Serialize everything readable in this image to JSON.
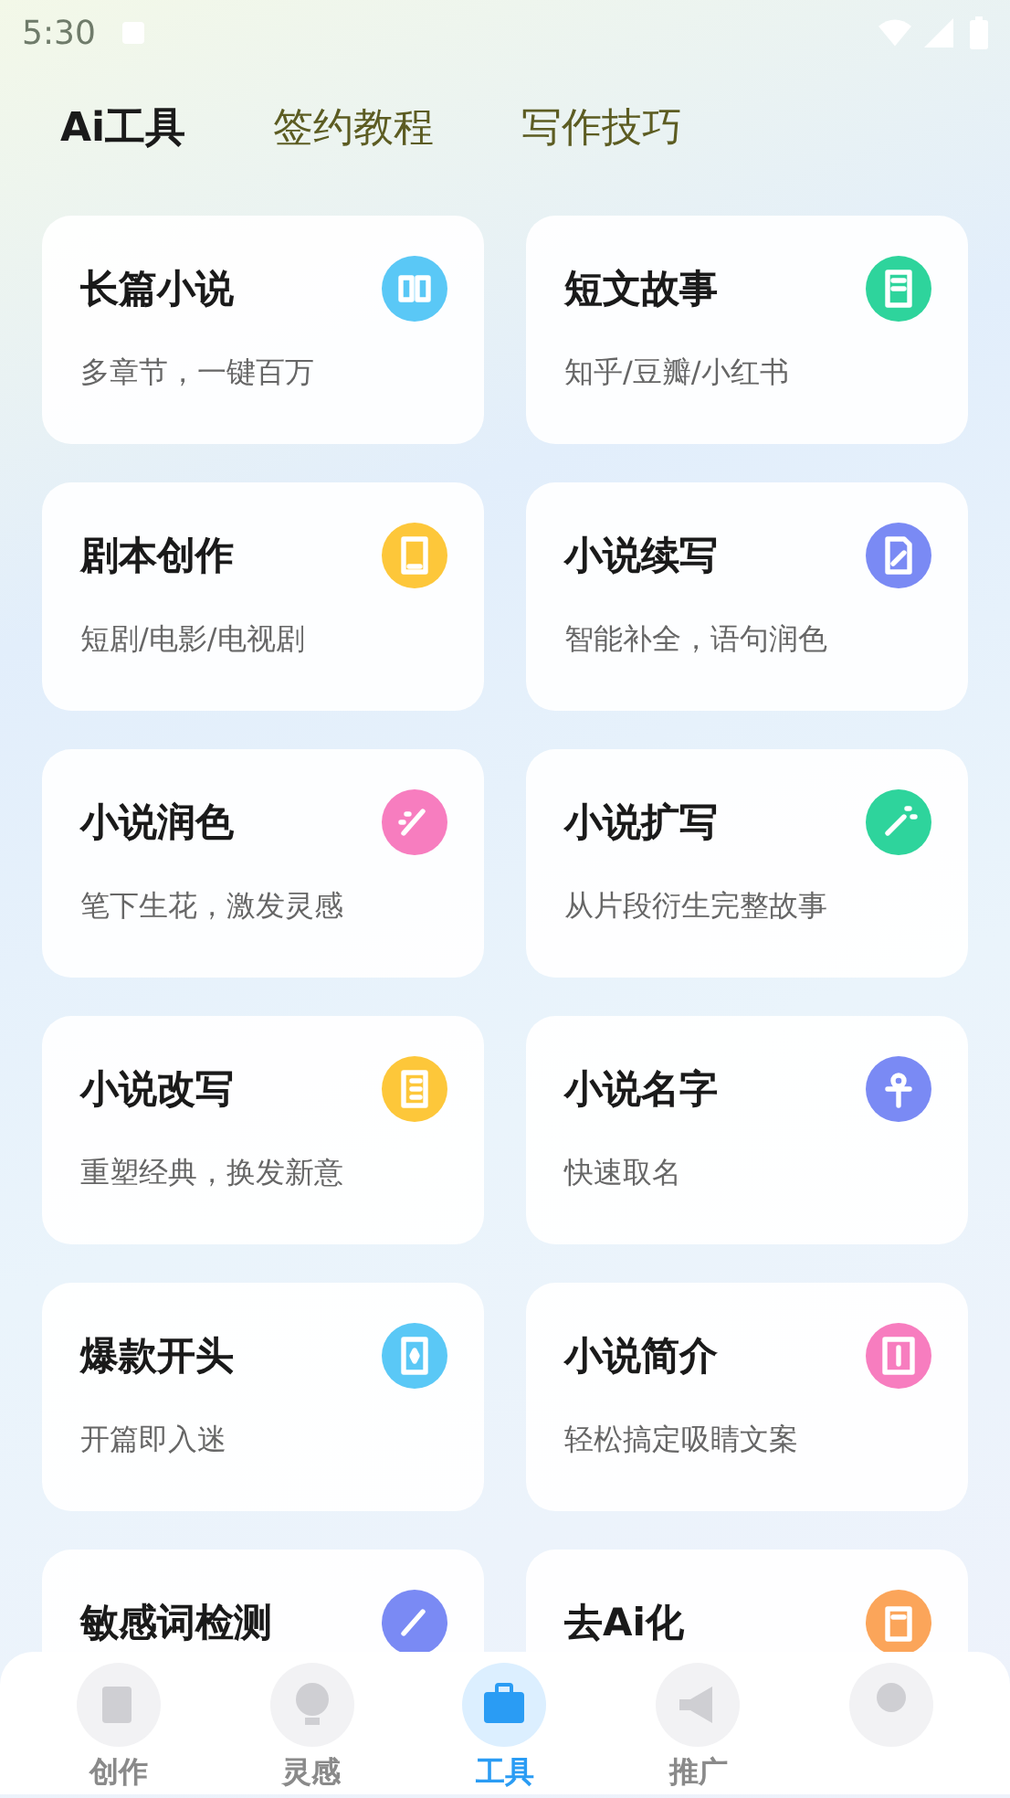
{
  "status_bar": {
    "time": "5:30"
  },
  "tabs": [
    {
      "label": "Ai工具",
      "selected": true
    },
    {
      "label": "签约教程",
      "selected": false
    },
    {
      "label": "写作技巧",
      "selected": false
    }
  ],
  "tools": [
    {
      "title": "长篇小说",
      "subtitle": "多章节，一键百万",
      "color": "#5ac8f6"
    },
    {
      "title": "短文故事",
      "subtitle": "知乎/豆瓣/小红书",
      "color": "#2ed49c"
    },
    {
      "title": "剧本创作",
      "subtitle": "短剧/电影/电视剧",
      "color": "#fdc73a"
    },
    {
      "title": "小说续写",
      "subtitle": "智能补全，语句润色",
      "color": "#7a8af4"
    },
    {
      "title": "小说润色",
      "subtitle": "笔下生花，激发灵感",
      "color": "#f77dbf"
    },
    {
      "title": "小说扩写",
      "subtitle": "从片段衍生完整故事",
      "color": "#2ed49c"
    },
    {
      "title": "小说改写",
      "subtitle": "重塑经典，换发新意",
      "color": "#fdc73a"
    },
    {
      "title": "小说名字",
      "subtitle": "快速取名",
      "color": "#7a8af4"
    },
    {
      "title": "爆款开头",
      "subtitle": "开篇即入迷",
      "color": "#5ac8f6"
    },
    {
      "title": "小说简介",
      "subtitle": "轻松搞定吸睛文案",
      "color": "#f77dbf"
    },
    {
      "title": "敏感词检测",
      "color": "#7a8af4"
    },
    {
      "title": "去Ai化",
      "color": "#fba55a"
    }
  ],
  "nav": [
    {
      "label": "创作",
      "selected": false
    },
    {
      "label": "灵感",
      "selected": false
    },
    {
      "label": "工具",
      "selected": true
    },
    {
      "label": "推广",
      "selected": false
    },
    {
      "selected": false
    }
  ]
}
